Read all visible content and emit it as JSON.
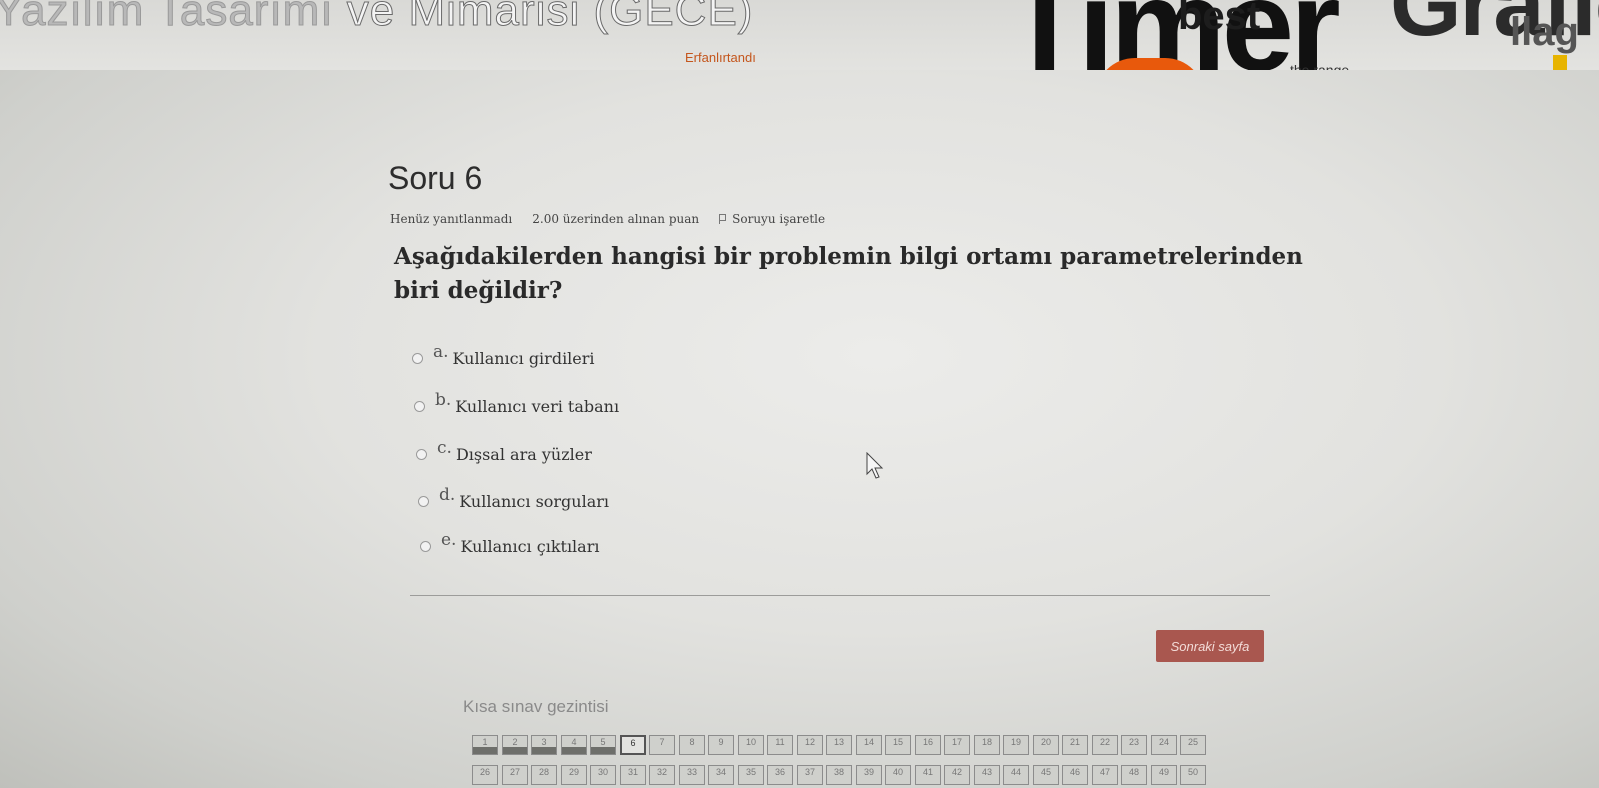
{
  "banner": {
    "course_title_left": "Yazılım Tasarımı ",
    "course_title_highlight": "ve Mimarisi (GECE)",
    "wordcloud": {
      "big_word": "Timer",
      "best": "best",
      "graph_word": "Grafic",
      "orange_word": "Erfanlırtandı",
      "dark_word": "the range",
      "right_word": "llag"
    }
  },
  "question": {
    "heading": "Soru 6",
    "status": "Henüz yanıtlanmadı",
    "points": "2.00 üzerinden alınan puan",
    "flag_label": "Soruyu işaretle",
    "text": "Aşağıdakilerden hangisi bir problemin bilgi ortamı parametrelerinden biri değildir?",
    "answers": [
      {
        "letter": "a.",
        "label": "Kullanıcı girdileri"
      },
      {
        "letter": "b.",
        "label": "Kullanıcı veri tabanı"
      },
      {
        "letter": "c.",
        "label": "Dışsal ara yüzler"
      },
      {
        "letter": "d.",
        "label": "Kullanıcı sorguları"
      },
      {
        "letter": "e.",
        "label": "Kullanıcı çıktıları"
      }
    ]
  },
  "next_button_label": "Sonraki sayfa",
  "nav": {
    "title": "Kısa sınav gezintisi",
    "row1": [
      "1",
      "2",
      "3",
      "4",
      "5",
      "6",
      "7",
      "8",
      "9",
      "10",
      "11",
      "12",
      "13",
      "14",
      "15",
      "16",
      "17",
      "18",
      "19",
      "20",
      "21",
      "22",
      "23",
      "24",
      "25"
    ],
    "row2": [
      "26",
      "27",
      "28",
      "29",
      "30",
      "31",
      "32",
      "33",
      "34",
      "35",
      "36",
      "37",
      "38",
      "39",
      "40",
      "41",
      "42",
      "43",
      "44",
      "45",
      "46",
      "47",
      "48",
      "49",
      "50"
    ],
    "answered_count": 5,
    "current": "6"
  }
}
